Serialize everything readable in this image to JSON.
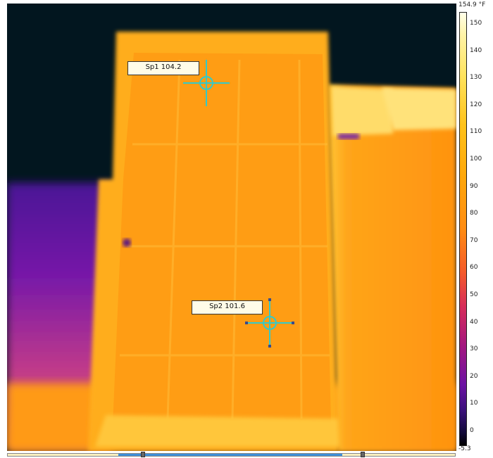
{
  "spots": [
    {
      "label": "Sp1 104.2"
    },
    {
      "label": "Sp2 101.6"
    }
  ],
  "scale": {
    "max_label": "154.9 °F",
    "min_label": "-5.3",
    "ticks": [
      "150",
      "140",
      "130",
      "120",
      "110",
      "100",
      "90",
      "80",
      "70",
      "60",
      "50",
      "40",
      "30",
      "20",
      "10",
      "0"
    ],
    "palette": "iron"
  },
  "timeline": {
    "accent": "#3e8fd8"
  },
  "colors": {
    "crosshair": "#33c9c9",
    "background": "#02161f"
  }
}
